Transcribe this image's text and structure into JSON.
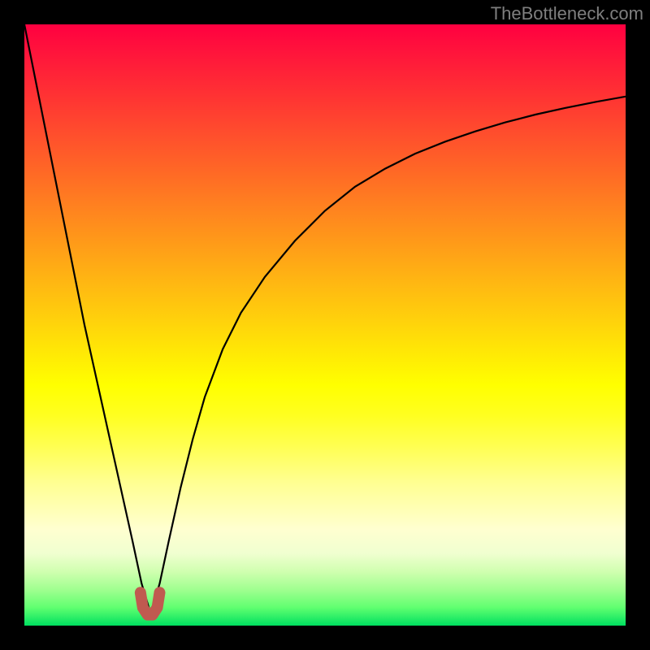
{
  "watermark": "TheBottleneck.com",
  "colors": {
    "curve": "#000000",
    "marker": "#c05a50",
    "frame": "#000000",
    "watermark": "#7f7f7f"
  },
  "chart_data": {
    "type": "line",
    "title": "",
    "xlabel": "",
    "ylabel": "",
    "xlim": [
      0,
      100
    ],
    "ylim": [
      0,
      100
    ],
    "grid": false,
    "legend": false,
    "note": "Axes are unlabeled in the image. x and y are read in percent of the plot area (0 = left/bottom, 100 = right/top). Curve is a V-shape with minimum near x≈21, y≈2; both branches rise steeply, the right branch tapering toward y≈88 at x=100.",
    "series": [
      {
        "name": "bottleneck_curve",
        "x": [
          0,
          2,
          4,
          6,
          8,
          10,
          12,
          14,
          16,
          18,
          19.5,
          21,
          22.5,
          24,
          26,
          28,
          30,
          33,
          36,
          40,
          45,
          50,
          55,
          60,
          65,
          70,
          75,
          80,
          85,
          90,
          95,
          100
        ],
        "y": [
          100,
          90,
          80,
          70,
          60,
          50,
          41,
          32,
          23,
          14,
          7,
          2,
          7,
          14,
          23,
          31,
          38,
          46,
          52,
          58,
          64,
          69,
          73,
          76,
          78.5,
          80.5,
          82.2,
          83.7,
          85,
          86.1,
          87.1,
          88
        ]
      },
      {
        "name": "minimum_marker",
        "x": [
          19.3,
          19.7,
          20.5,
          21.3,
          22.1,
          22.5
        ],
        "y": [
          5.5,
          3.0,
          1.8,
          1.8,
          3.0,
          5.5
        ]
      }
    ]
  }
}
